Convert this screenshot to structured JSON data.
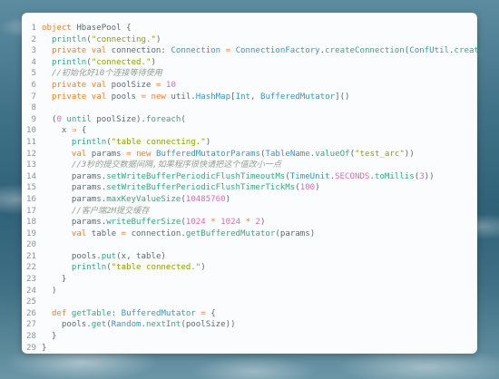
{
  "editor": {
    "lines": [
      {
        "num": "1",
        "tokens": [
          [
            "k",
            "object"
          ],
          [
            "p",
            " HbasePool {"
          ]
        ]
      },
      {
        "num": "2",
        "tokens": [
          [
            "p",
            "  "
          ],
          [
            "f",
            "println"
          ],
          [
            "p",
            "("
          ],
          [
            "s",
            "\"connecting.\""
          ],
          [
            "p",
            ")"
          ]
        ]
      },
      {
        "num": "3",
        "tokens": [
          [
            "p",
            "  "
          ],
          [
            "k",
            "private val"
          ],
          [
            "p",
            " connection: "
          ],
          [
            "t",
            "Connection"
          ],
          [
            "p",
            " "
          ],
          [
            "o",
            "="
          ],
          [
            "p",
            " "
          ],
          [
            "t",
            "ConnectionFactory"
          ],
          [
            "p",
            "."
          ],
          [
            "f",
            "createConnection"
          ],
          [
            "p",
            "("
          ],
          [
            "t",
            "ConfUtil"
          ],
          [
            "p",
            "."
          ],
          [
            "f",
            "createConf"
          ],
          [
            "p",
            ")"
          ]
        ]
      },
      {
        "num": "4",
        "tokens": [
          [
            "p",
            "  "
          ],
          [
            "f",
            "println"
          ],
          [
            "p",
            "("
          ],
          [
            "s",
            "\"connected.\""
          ],
          [
            "p",
            ")"
          ]
        ]
      },
      {
        "num": "5",
        "tokens": [
          [
            "p",
            "  "
          ],
          [
            "c",
            "//初始化好10个连接等待使用"
          ]
        ]
      },
      {
        "num": "6",
        "tokens": [
          [
            "p",
            "  "
          ],
          [
            "k",
            "private val"
          ],
          [
            "p",
            " poolSize "
          ],
          [
            "o",
            "="
          ],
          [
            "p",
            " "
          ],
          [
            "n",
            "10"
          ]
        ]
      },
      {
        "num": "7",
        "tokens": [
          [
            "p",
            "  "
          ],
          [
            "k",
            "private val"
          ],
          [
            "p",
            " pools "
          ],
          [
            "o",
            "="
          ],
          [
            "p",
            " "
          ],
          [
            "k",
            "new"
          ],
          [
            "p",
            " util."
          ],
          [
            "t",
            "HashMap"
          ],
          [
            "p",
            "["
          ],
          [
            "t",
            "Int"
          ],
          [
            "p",
            ", "
          ],
          [
            "t",
            "BufferedMutator"
          ],
          [
            "p",
            "]()"
          ]
        ]
      },
      {
        "num": "8",
        "tokens": []
      },
      {
        "num": "9",
        "tokens": [
          [
            "p",
            "  ("
          ],
          [
            "n",
            "0"
          ],
          [
            "p",
            " "
          ],
          [
            "f",
            "until"
          ],
          [
            "p",
            " poolSize)."
          ],
          [
            "f",
            "foreach"
          ],
          [
            "p",
            "("
          ]
        ]
      },
      {
        "num": "10",
        "tokens": [
          [
            "p",
            "    x "
          ],
          [
            "o",
            "⇒"
          ],
          [
            "p",
            " {"
          ]
        ]
      },
      {
        "num": "11",
        "tokens": [
          [
            "p",
            "      "
          ],
          [
            "f",
            "println"
          ],
          [
            "p",
            "("
          ],
          [
            "s",
            "\"table connecting.\""
          ],
          [
            "p",
            ")"
          ]
        ]
      },
      {
        "num": "12",
        "tokens": [
          [
            "p",
            "      "
          ],
          [
            "k",
            "val"
          ],
          [
            "p",
            " params "
          ],
          [
            "o",
            "="
          ],
          [
            "p",
            " "
          ],
          [
            "k",
            "new"
          ],
          [
            "p",
            " "
          ],
          [
            "t",
            "BufferedMutatorParams"
          ],
          [
            "p",
            "("
          ],
          [
            "t",
            "TableName"
          ],
          [
            "p",
            "."
          ],
          [
            "f",
            "valueOf"
          ],
          [
            "p",
            "("
          ],
          [
            "s",
            "\"test_arc\""
          ],
          [
            "p",
            "))"
          ]
        ]
      },
      {
        "num": "13",
        "tokens": [
          [
            "p",
            "      "
          ],
          [
            "c",
            "//3秒的提交数据间隔,如果程序很快请把这个值改小一点"
          ]
        ]
      },
      {
        "num": "14",
        "tokens": [
          [
            "p",
            "      params."
          ],
          [
            "f",
            "setWriteBufferPeriodicFlushTimeoutMs"
          ],
          [
            "p",
            "("
          ],
          [
            "t",
            "TimeUnit"
          ],
          [
            "p",
            "."
          ],
          [
            "n",
            "SECONDS"
          ],
          [
            "p",
            "."
          ],
          [
            "f",
            "toMillis"
          ],
          [
            "p",
            "("
          ],
          [
            "n",
            "3"
          ],
          [
            "p",
            "))"
          ]
        ]
      },
      {
        "num": "15",
        "tokens": [
          [
            "p",
            "      params."
          ],
          [
            "f",
            "setWriteBufferPeriodicFlushTimerTickMs"
          ],
          [
            "p",
            "("
          ],
          [
            "n",
            "100"
          ],
          [
            "p",
            ")"
          ]
        ]
      },
      {
        "num": "16",
        "tokens": [
          [
            "p",
            "      params."
          ],
          [
            "f",
            "maxKeyValueSize"
          ],
          [
            "p",
            "("
          ],
          [
            "n",
            "10485760"
          ],
          [
            "p",
            ")"
          ]
        ]
      },
      {
        "num": "17",
        "tokens": [
          [
            "p",
            "      "
          ],
          [
            "c",
            "//客户端2M提交缓存"
          ]
        ]
      },
      {
        "num": "18",
        "tokens": [
          [
            "p",
            "      params."
          ],
          [
            "f",
            "writeBufferSize"
          ],
          [
            "p",
            "("
          ],
          [
            "n",
            "1024"
          ],
          [
            "p",
            " "
          ],
          [
            "o",
            "*"
          ],
          [
            "p",
            " "
          ],
          [
            "n",
            "1024"
          ],
          [
            "p",
            " "
          ],
          [
            "o",
            "*"
          ],
          [
            "p",
            " "
          ],
          [
            "n",
            "2"
          ],
          [
            "p",
            ")"
          ]
        ]
      },
      {
        "num": "19",
        "tokens": [
          [
            "p",
            "      "
          ],
          [
            "k",
            "val"
          ],
          [
            "p",
            " table "
          ],
          [
            "o",
            "="
          ],
          [
            "p",
            " connection."
          ],
          [
            "f",
            "getBufferedMutator"
          ],
          [
            "p",
            "(params)"
          ]
        ]
      },
      {
        "num": "20",
        "tokens": []
      },
      {
        "num": "21",
        "tokens": [
          [
            "p",
            "      pools."
          ],
          [
            "f",
            "put"
          ],
          [
            "p",
            "(x, table)"
          ]
        ]
      },
      {
        "num": "22",
        "tokens": [
          [
            "p",
            "      "
          ],
          [
            "f",
            "println"
          ],
          [
            "p",
            "("
          ],
          [
            "s",
            "\"table connected.\""
          ],
          [
            "p",
            ")"
          ]
        ]
      },
      {
        "num": "23",
        "tokens": [
          [
            "p",
            "    }"
          ]
        ]
      },
      {
        "num": "24",
        "tokens": [
          [
            "p",
            "  )"
          ]
        ]
      },
      {
        "num": "25",
        "tokens": []
      },
      {
        "num": "26",
        "tokens": [
          [
            "p",
            "  "
          ],
          [
            "k",
            "def"
          ],
          [
            "p",
            " "
          ],
          [
            "f",
            "getTable"
          ],
          [
            "p",
            ": "
          ],
          [
            "t",
            "BufferedMutator"
          ],
          [
            "p",
            " "
          ],
          [
            "o",
            "="
          ],
          [
            "p",
            " {"
          ]
        ]
      },
      {
        "num": "27",
        "tokens": [
          [
            "p",
            "    pools."
          ],
          [
            "f",
            "get"
          ],
          [
            "p",
            "("
          ],
          [
            "t",
            "Random"
          ],
          [
            "p",
            "."
          ],
          [
            "f",
            "nextInt"
          ],
          [
            "p",
            "(poolSize))"
          ]
        ]
      },
      {
        "num": "28",
        "tokens": [
          [
            "p",
            "  }"
          ]
        ]
      },
      {
        "num": "29",
        "tokens": [
          [
            "p",
            "}"
          ]
        ]
      }
    ]
  },
  "colors": {
    "keyword": "#f57d26",
    "string": "#8da101",
    "type": "#3a94c5",
    "function": "#35a77c",
    "number": "#df69ba",
    "comment": "#939f91",
    "plain": "#5c6a72",
    "card_background": "#fbfcfd"
  }
}
